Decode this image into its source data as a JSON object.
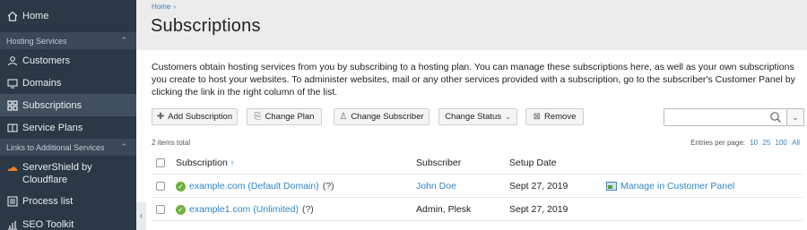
{
  "sidebar": {
    "home": "Home",
    "section_hosting": "Hosting Services",
    "items": [
      {
        "label": "Customers"
      },
      {
        "label": "Domains"
      },
      {
        "label": "Subscriptions"
      },
      {
        "label": "Service Plans"
      }
    ],
    "section_links": "Links to Additional Services",
    "links": [
      {
        "label": "ServerShield by Cloudflare"
      },
      {
        "label": "Process list"
      },
      {
        "label": "SEO Toolkit"
      }
    ]
  },
  "breadcrumb": {
    "home": "Home",
    "sep": "›"
  },
  "page": {
    "title": "Subscriptions",
    "intro": "Customers obtain hosting services from you by subscribing to a hosting plan. You can manage these subscriptions here, as well as your own subscriptions you create to host your websites. To administer websites, mail or any other services provided with a subscription, go to the subscriber's Customer Panel by clicking the link in the right column of the list."
  },
  "toolbar": {
    "add_subscription": "Add Subscription",
    "change_plan": "Change Plan",
    "change_subscriber": "Change Subscriber",
    "change_status": "Change Status",
    "remove": "Remove",
    "search_value": ""
  },
  "list": {
    "total": "2 items total",
    "entries_label": "Entries per page:",
    "page_sizes": [
      "10",
      "25",
      "100",
      "All"
    ]
  },
  "table": {
    "headers": {
      "subscription": "Subscription",
      "subscriber": "Subscriber",
      "setup_date": "Setup Date"
    },
    "rows": [
      {
        "subscription": "example.com (Default Domain)",
        "help": "(?)",
        "subscriber": "John Doe",
        "setup_date": "Sept 27, 2019",
        "action": "Manage in Customer Panel"
      },
      {
        "subscription": "example1.com (Unlimited)",
        "help": "(?)",
        "subscriber": "Admin, Plesk",
        "setup_date": "Sept 27, 2019",
        "action": ""
      }
    ]
  },
  "colors": {
    "sidebar_bg": "#2b3845",
    "link": "#2f86c7",
    "status_ok": "#6cb33f"
  }
}
